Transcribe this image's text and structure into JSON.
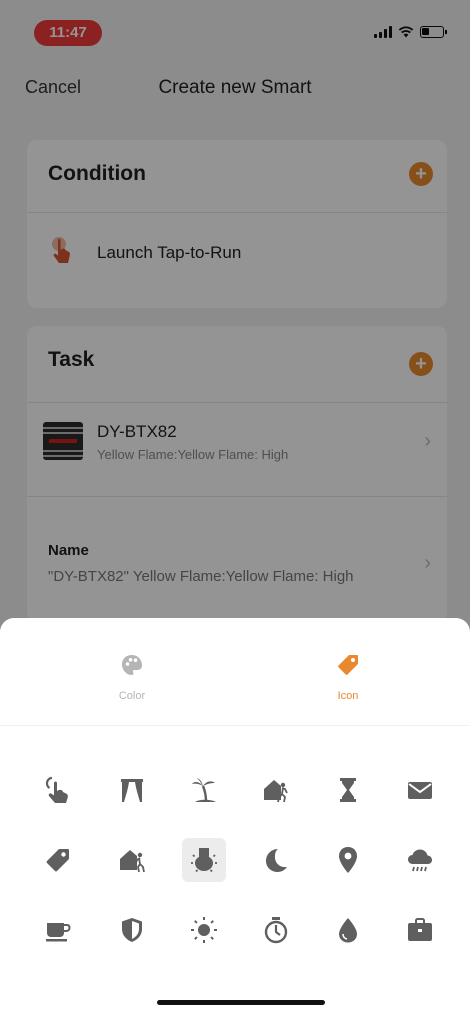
{
  "status_bar": {
    "time": "11:47"
  },
  "navbar": {
    "cancel_label": "Cancel",
    "title": "Create new Smart"
  },
  "condition": {
    "header": "Condition",
    "add_icon": "plus-circle-icon",
    "row_label": "Launch Tap-to-Run",
    "row_icon": "tap-icon"
  },
  "task": {
    "header": "Task",
    "add_icon": "plus-circle-icon",
    "device_name": "DY-BTX82",
    "device_action": "Yellow Flame:Yellow Flame: High",
    "name_label": "Name",
    "name_value": "\"DY-BTX82\" Yellow Flame:Yellow Flame: High",
    "chevron": "›"
  },
  "sheet": {
    "tabs": [
      {
        "label": "Color",
        "icon": "palette-icon",
        "active": false
      },
      {
        "label": "Icon",
        "icon": "tag-icon",
        "active": true
      }
    ],
    "icons": [
      "tap-icon",
      "curtain-icon",
      "beach-icon",
      "leave-home-icon",
      "hourglass-icon",
      "mail-icon",
      "tag-icon",
      "arrive-home-icon",
      "bulb-icon",
      "moon-icon",
      "location-pin-icon",
      "rain-cloud-icon",
      "coffee-cup-icon",
      "shield-icon",
      "sun-icon",
      "timer-icon",
      "water-drop-icon",
      "briefcase-icon"
    ],
    "selected_icon": "bulb-icon"
  },
  "colors": {
    "accent": "#e8892e",
    "accent_dim": "#caa577",
    "status_pill": "#f23a3a",
    "icon_gray": "#5f5f5f",
    "tab_inactive": "#b5b5b5"
  }
}
